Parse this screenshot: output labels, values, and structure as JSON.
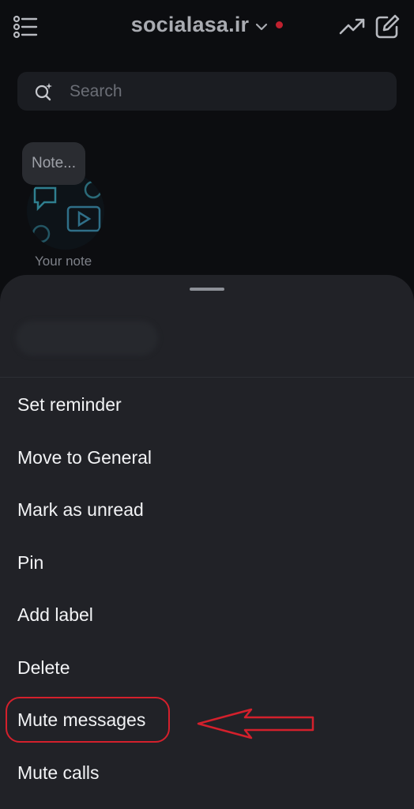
{
  "header": {
    "title": "socialasa.ir",
    "menu_icon": "list-icon",
    "trend_icon": "trending-up-icon",
    "compose_icon": "compose-icon",
    "dot_color": "#c0212f"
  },
  "search": {
    "placeholder": "Search"
  },
  "note": {
    "bubble_text": "Note...",
    "label": "Your note"
  },
  "sheet": {
    "items": [
      {
        "label": "Set reminder"
      },
      {
        "label": "Move to General"
      },
      {
        "label": "Mark as unread"
      },
      {
        "label": "Pin"
      },
      {
        "label": "Add label"
      },
      {
        "label": "Delete"
      },
      {
        "label": "Mute messages"
      },
      {
        "label": "Mute calls"
      }
    ]
  },
  "annotation": {
    "color": "#d4202c",
    "highlighted_item": "Mute messages"
  }
}
